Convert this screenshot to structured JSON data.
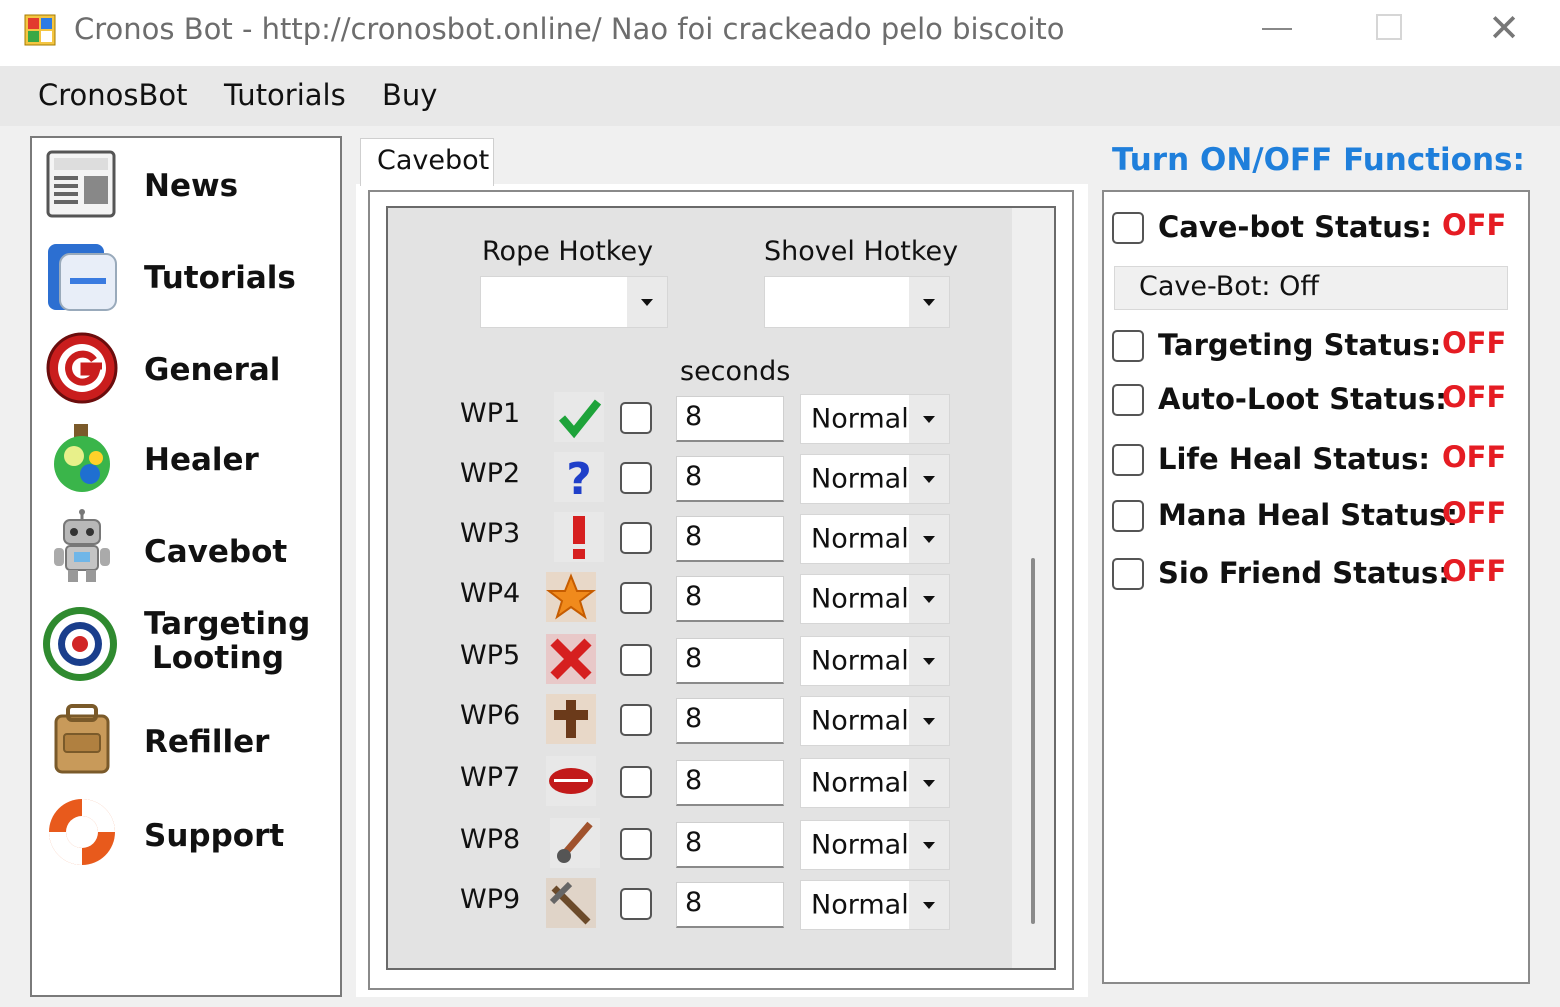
{
  "window": {
    "title": "Cronos Bot - http://cronosbot.online/ Nao foi crackeado pelo biscoito",
    "minimize_icon": "minimize-icon",
    "maximize_icon": "maximize-icon",
    "close_icon": "close-icon",
    "close_glyph": "✕"
  },
  "menu": [
    "CronosBot",
    "Tutorials",
    "Buy"
  ],
  "sidebar": {
    "items": [
      {
        "label": "News",
        "icon": "newspaper-icon"
      },
      {
        "label": "Tutorials",
        "icon": "tutorial-book-icon"
      },
      {
        "label": "General",
        "icon": "g-logo-icon"
      },
      {
        "label": "Healer",
        "icon": "potion-icon"
      },
      {
        "label": "Cavebot",
        "icon": "robot-icon"
      },
      {
        "label": "Targeting",
        "label2": "Looting",
        "icon": "target-icon"
      },
      {
        "label": "Refiller",
        "icon": "backpack-icon"
      },
      {
        "label": "Support",
        "icon": "lifebuoy-icon"
      }
    ]
  },
  "tab": {
    "label": "Cavebot"
  },
  "hotkeys": {
    "rope_label": "Rope Hotkey",
    "rope_value": "",
    "shovel_label": "Shovel Hotkey",
    "shovel_value": ""
  },
  "seconds_label": "seconds",
  "waypoints": [
    {
      "label": "WP1",
      "icon": "checkmark-icon",
      "checked": false,
      "seconds": "8",
      "mode": "Normal"
    },
    {
      "label": "WP2",
      "icon": "question-mark-icon",
      "checked": false,
      "seconds": "8",
      "mode": "Normal"
    },
    {
      "label": "WP3",
      "icon": "exclamation-icon",
      "checked": false,
      "seconds": "8",
      "mode": "Normal"
    },
    {
      "label": "WP4",
      "icon": "star-icon",
      "checked": false,
      "seconds": "8",
      "mode": "Normal"
    },
    {
      "label": "WP5",
      "icon": "red-cross-icon",
      "checked": false,
      "seconds": "8",
      "mode": "Normal"
    },
    {
      "label": "WP6",
      "icon": "brown-cross-icon",
      "checked": false,
      "seconds": "8",
      "mode": "Normal"
    },
    {
      "label": "WP7",
      "icon": "lips-icon",
      "checked": false,
      "seconds": "8",
      "mode": "Normal"
    },
    {
      "label": "WP8",
      "icon": "sword-icon",
      "checked": false,
      "seconds": "8",
      "mode": "Normal"
    },
    {
      "label": "WP9",
      "icon": "pick-icon",
      "checked": false,
      "seconds": "8",
      "mode": "Normal"
    }
  ],
  "functions": {
    "title": "Turn ON/OFF Functions:",
    "cavebot_status_text": "Cave-Bot: Off",
    "items": [
      {
        "label": "Cave-bot Status:",
        "value": "OFF",
        "checked": false
      },
      {
        "label": "Targeting Status:",
        "value": "OFF",
        "checked": false
      },
      {
        "label": "Auto-Loot Status:",
        "value": "OFF",
        "checked": false
      },
      {
        "label": "Life Heal Status:",
        "value": "OFF",
        "checked": false
      },
      {
        "label": "Mana Heal Status:",
        "value": "OFF",
        "checked": false
      },
      {
        "label": "Sio Friend Status:",
        "value": "OFF",
        "checked": false
      }
    ]
  },
  "colors": {
    "accent_blue": "#1f7fdb",
    "off_red": "#e51c23",
    "panel_grey": "#e3e3e3"
  }
}
